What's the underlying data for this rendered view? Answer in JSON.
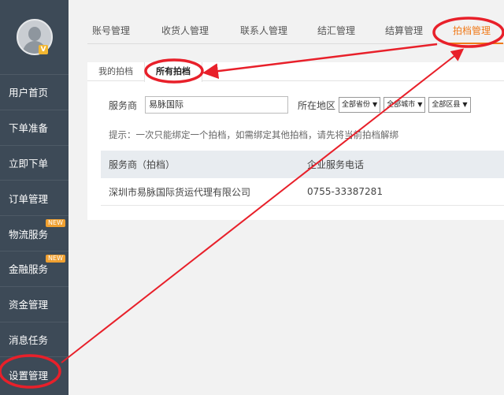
{
  "sidebar": {
    "items": [
      {
        "label": "用户首页",
        "new": ""
      },
      {
        "label": "下单准备",
        "new": ""
      },
      {
        "label": "立即下单",
        "new": ""
      },
      {
        "label": "订单管理",
        "new": ""
      },
      {
        "label": "物流服务",
        "new": "NEW"
      },
      {
        "label": "金融服务",
        "new": "NEW"
      },
      {
        "label": "资金管理",
        "new": ""
      },
      {
        "label": "消息任务",
        "new": ""
      },
      {
        "label": "设置管理",
        "new": ""
      }
    ],
    "avatar_badge": "V"
  },
  "top_tabs": [
    {
      "label": "账号管理"
    },
    {
      "label": "收货人管理"
    },
    {
      "label": "联系人管理"
    },
    {
      "label": "结汇管理"
    },
    {
      "label": "结算管理"
    },
    {
      "label": "拍档管理"
    }
  ],
  "sub_tabs": [
    {
      "label": "我的拍档"
    },
    {
      "label": "所有拍档"
    }
  ],
  "filter": {
    "provider_label": "服务商",
    "provider_value": "易脉国际",
    "region_label": "所在地区",
    "province": "全部省份",
    "city": "全部城市",
    "district": "全部区县"
  },
  "tip": "提示：一次只能绑定一个拍档，如需绑定其他拍档，请先将当前拍档解绑",
  "table": {
    "headers": [
      "服务商（拍档）",
      "企业服务电话"
    ],
    "rows": [
      [
        "深圳市易脉国际货运代理有限公司",
        "0755-33387281"
      ]
    ]
  },
  "colors": {
    "accent": "#f07a1a",
    "sidebar_bg": "#3d4a57",
    "annotation": "#e8202a"
  }
}
